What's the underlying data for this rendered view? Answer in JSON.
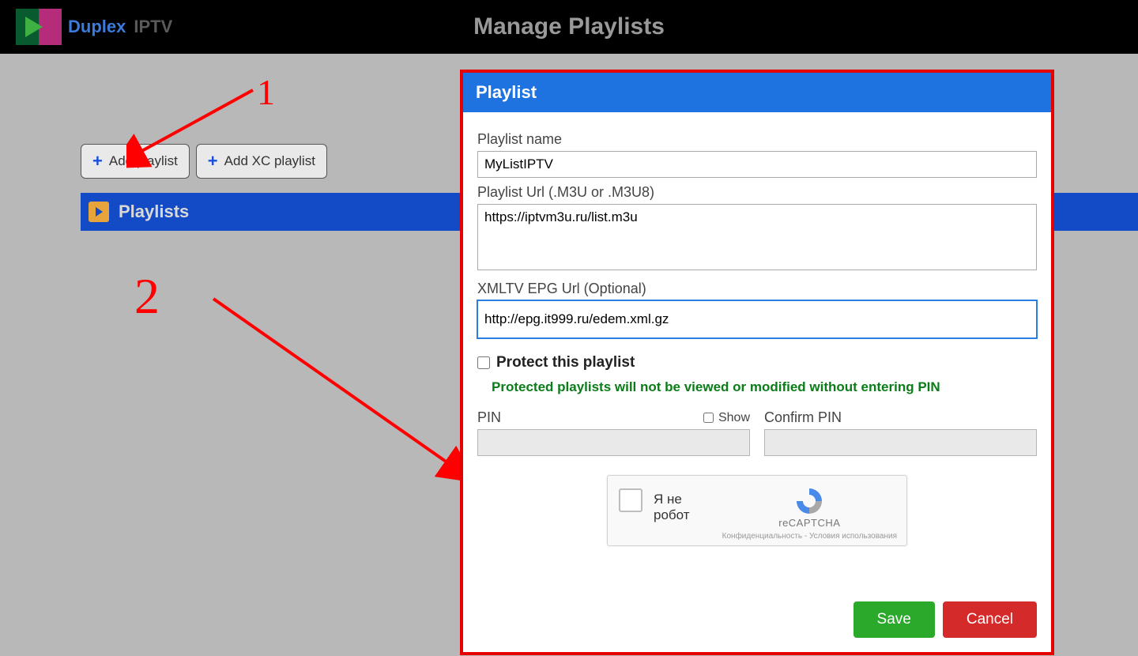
{
  "logo": {
    "text1": "Duplex",
    "text2": "IPTV"
  },
  "page_title": "Manage Playlists",
  "toolbar": {
    "add_playlist": "Add playlist",
    "add_xc_playlist": "Add XC playlist"
  },
  "sidebar": {
    "playlists_label": "Playlists"
  },
  "annotations": {
    "num1": "1",
    "num2": "2"
  },
  "dialog": {
    "title": "Playlist",
    "name_label": "Playlist name",
    "name_value": "MyListIPTV",
    "url_label": "Playlist Url (.M3U or .M3U8)",
    "url_value": "https://iptvm3u.ru/list.m3u",
    "epg_label": "XMLTV EPG Url (Optional)",
    "epg_value": "http://epg.it999.ru/edem.xml.gz",
    "protect_label": "Protect this playlist",
    "protect_note": "Protected playlists will not be viewed or modified without entering PIN",
    "pin_label": "PIN",
    "show_label": "Show",
    "confirm_pin_label": "Confirm PIN",
    "captcha_text": "Я не робот",
    "captcha_brand": "reCAPTCHA",
    "captcha_legal": "Конфиденциальность - Условия использования",
    "save_label": "Save",
    "cancel_label": "Cancel"
  }
}
